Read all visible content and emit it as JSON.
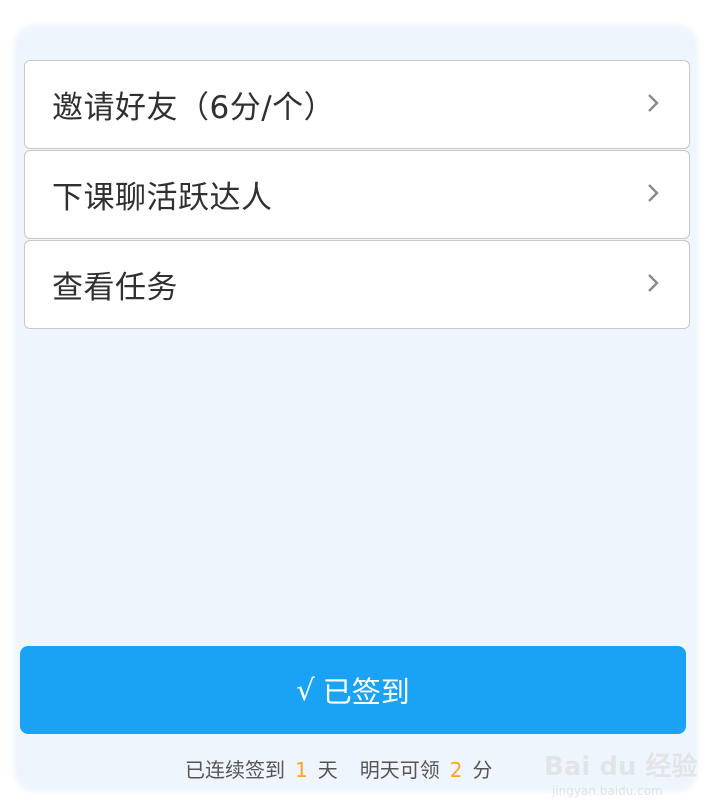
{
  "menu": {
    "items": [
      {
        "label": "邀请好友（6分/个）",
        "icon": "chevron-right-icon"
      },
      {
        "label": "下课聊活跃达人",
        "icon": "chevron-right-icon"
      },
      {
        "label": "查看任务",
        "icon": "chevron-right-icon"
      }
    ]
  },
  "signin": {
    "check": "√",
    "label": "已签到"
  },
  "streak": {
    "prefix": "已连续签到",
    "days": "1",
    "days_unit": "天",
    "tomorrow": "明天可领",
    "points": "2",
    "points_unit": "分"
  },
  "watermark": {
    "logo": "Bai du 经验",
    "url": "jingyan.baidu.com"
  },
  "colors": {
    "accent": "#1aa3f5",
    "highlight": "#f5a623",
    "background": "#eef5fc"
  }
}
